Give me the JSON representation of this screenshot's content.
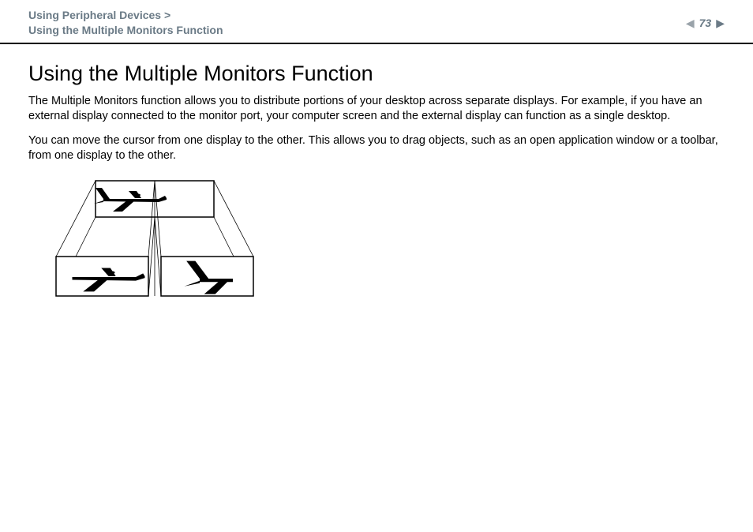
{
  "header": {
    "breadcrumb_line1": "Using Peripheral Devices >",
    "breadcrumb_line2": "Using the Multiple Monitors Function",
    "page_number": "73"
  },
  "content": {
    "title": "Using the Multiple Monitors Function",
    "paragraph1": "The Multiple Monitors function allows you to distribute portions of your desktop across separate displays. For example, if you have an external display connected to the monitor port, your computer screen and the external display can function as a single desktop.",
    "paragraph2": "You can move the cursor from one display to the other. This allows you to drag objects, such as an open application window or a toolbar, from one display to the other."
  }
}
